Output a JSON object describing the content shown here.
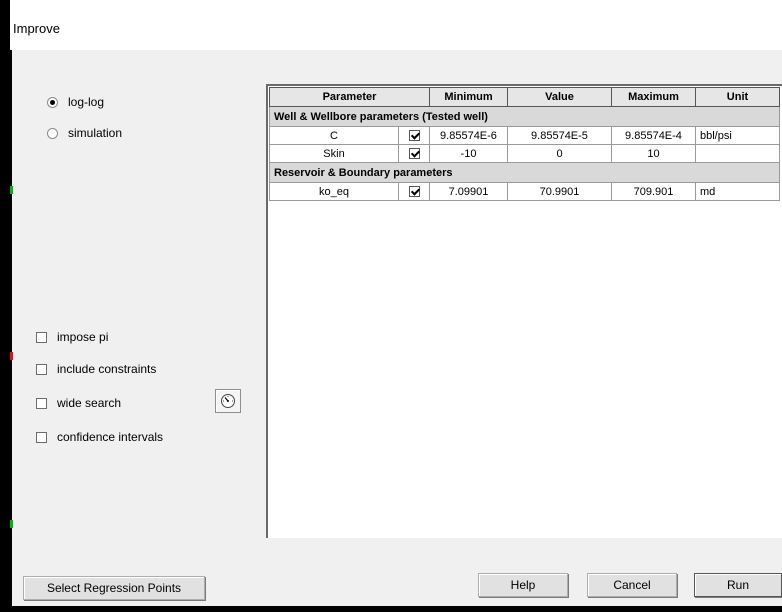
{
  "window": {
    "title": "Improve"
  },
  "mode": {
    "options": [
      {
        "label": "log-log",
        "selected": true
      },
      {
        "label": "simulation",
        "selected": false
      }
    ]
  },
  "options": {
    "impose_pi": {
      "label": "impose pi",
      "checked": false
    },
    "include_constraints": {
      "label": "include constraints",
      "checked": false
    },
    "wide_search": {
      "label": "wide search",
      "checked": false
    },
    "confidence_intervals": {
      "label": "confidence intervals",
      "checked": false
    },
    "gauge_icon": "gauge-icon"
  },
  "table": {
    "headers": {
      "parameter": "Parameter",
      "minimum": "Minimum",
      "value": "Value",
      "maximum": "Maximum",
      "unit": "Unit"
    },
    "groups": [
      {
        "title": "Well & Wellbore parameters (Tested well)",
        "rows": [
          {
            "parameter": "C",
            "checked": true,
            "minimum": "9.85574E-6",
            "value": "9.85574E-5",
            "maximum": "9.85574E-4",
            "unit": "bbl/psi"
          },
          {
            "parameter": "Skin",
            "checked": true,
            "minimum": "-10",
            "value": "0",
            "maximum": "10",
            "unit": ""
          }
        ]
      },
      {
        "title": "Reservoir & Boundary parameters",
        "rows": [
          {
            "parameter": "ko_eq",
            "checked": true,
            "minimum": "7.09901",
            "value": "70.9901",
            "maximum": "709.901",
            "unit": "md"
          }
        ]
      }
    ]
  },
  "buttons": {
    "select_regression": "Select Regression Points",
    "help": "Help",
    "cancel": "Cancel",
    "run": "Run"
  }
}
